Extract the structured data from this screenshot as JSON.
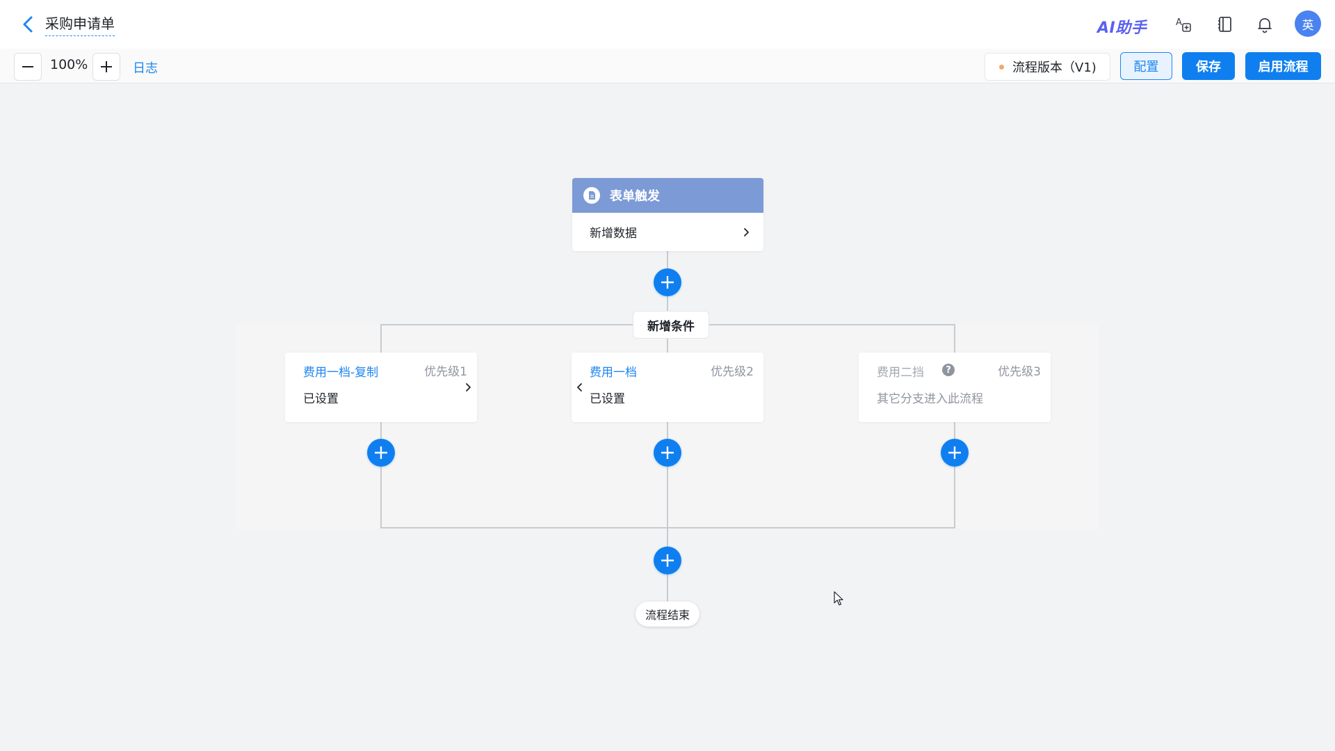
{
  "header": {
    "title": "采购申请单",
    "ai_assistant": "AI助手",
    "avatar_text": "英"
  },
  "toolbar": {
    "zoom": "100%",
    "log_label": "日志",
    "version_label": "流程版本（V1)",
    "config_label": "配置",
    "save_label": "保存",
    "enable_label": "启用流程"
  },
  "flow": {
    "trigger": {
      "title": "表单触发",
      "action": "新增数据"
    },
    "add_condition_label": "新增条件",
    "branches": [
      {
        "name": "费用一档-复制",
        "priority": "优先级1",
        "desc": "已设置"
      },
      {
        "name": "费用一档",
        "priority": "优先级2",
        "desc": "已设置"
      },
      {
        "name": "费用二挡",
        "priority": "优先级3",
        "desc": "其它分支进入此流程"
      }
    ],
    "end_label": "流程结束"
  },
  "colors": {
    "primary": "#0f7ff0",
    "trigger_header": "#7b9ad6",
    "link": "#1e86f0"
  }
}
